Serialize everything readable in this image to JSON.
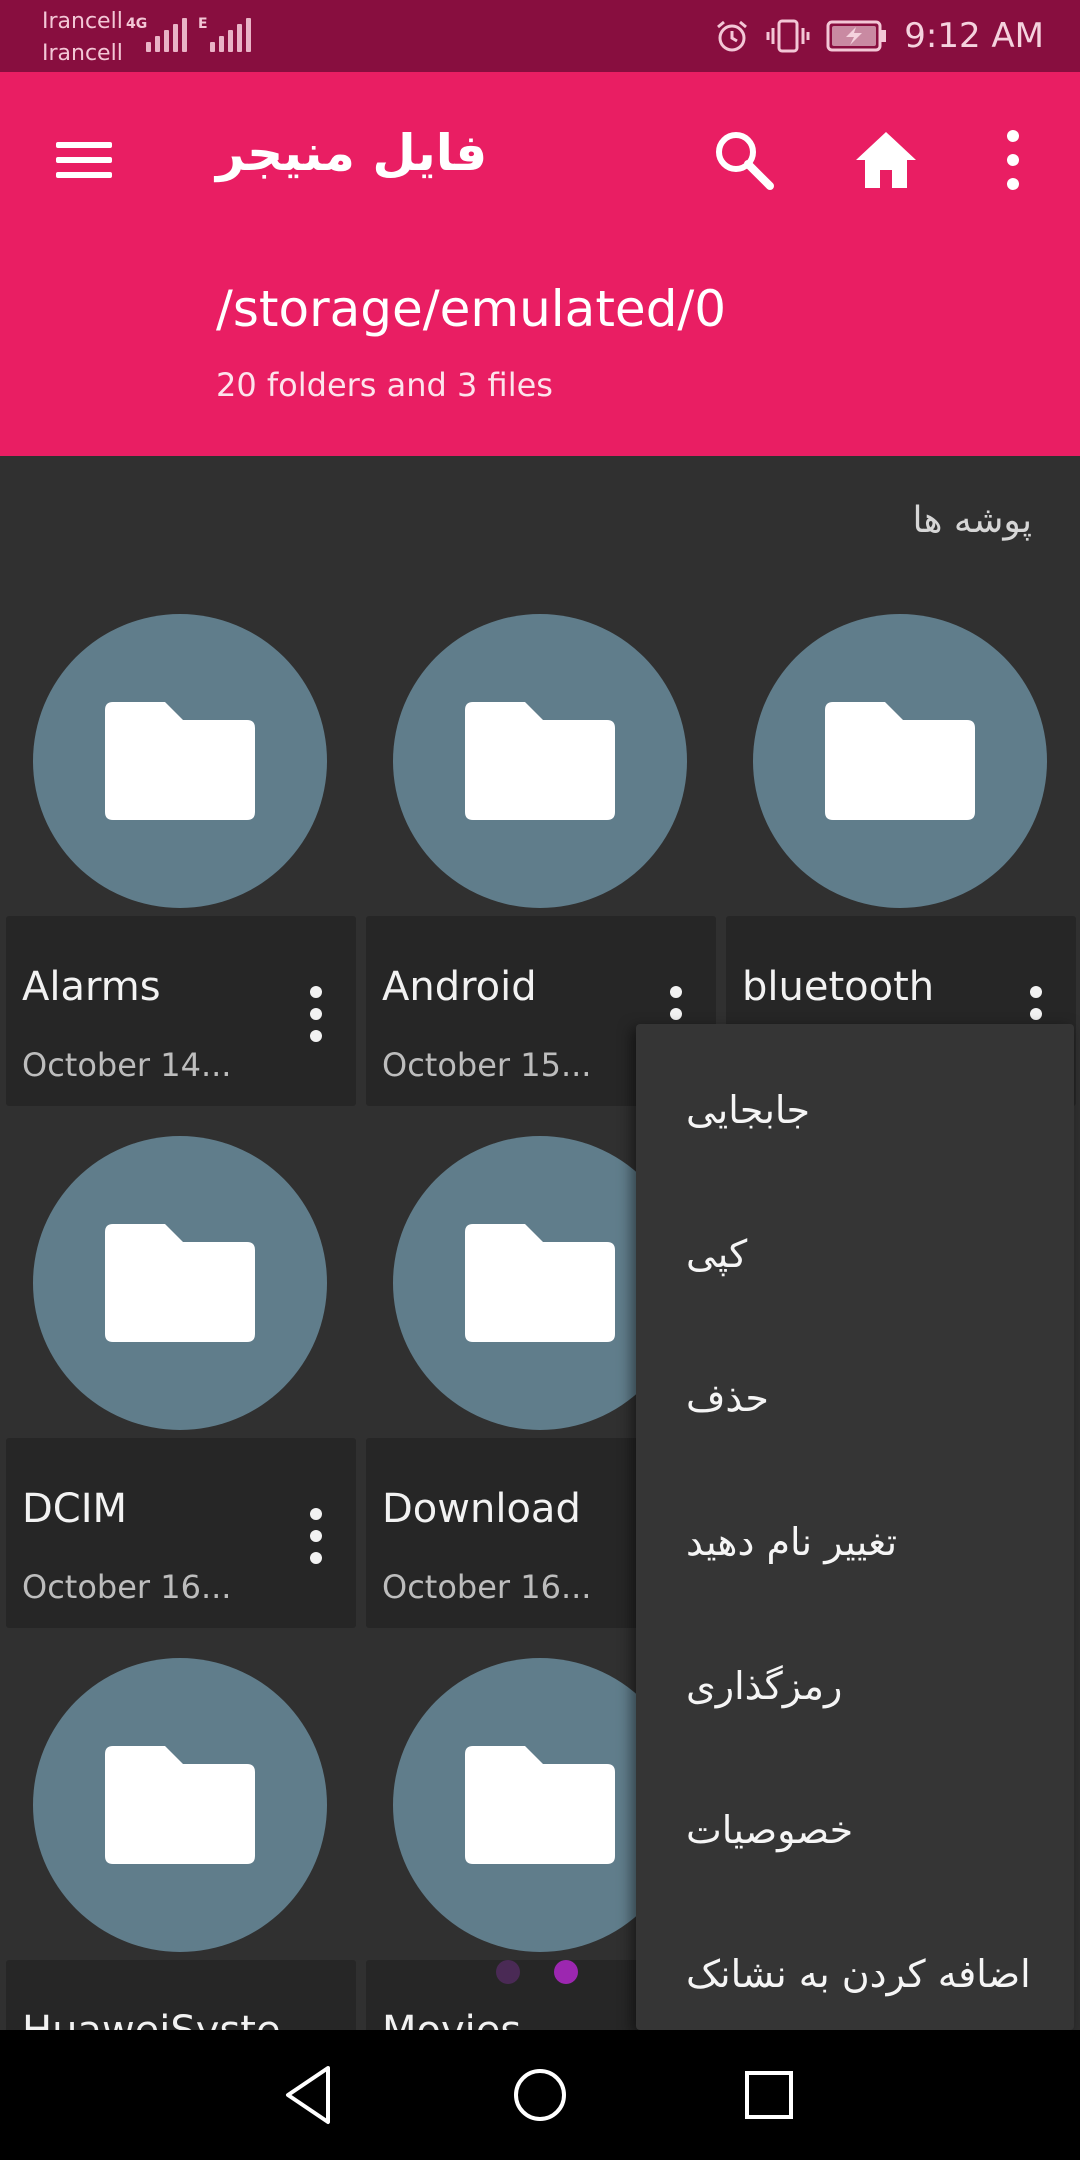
{
  "status_bar": {
    "carrier1": "Irancell",
    "carrier2": "Irancell",
    "net1": "4G",
    "net2": "E",
    "time": "9:12 AM",
    "icons": [
      "alarm-icon",
      "vibrate-icon",
      "battery-charging-icon"
    ]
  },
  "app_bar": {
    "title": "فایل منیجر",
    "path": "/storage/emulated/0",
    "summary": "20 folders and 3 files",
    "icons": [
      "menu-icon",
      "search-icon",
      "home-icon",
      "more-vert-icon"
    ]
  },
  "section": {
    "title": "پوشه ها"
  },
  "folders": [
    {
      "name": "Alarms",
      "date": "October 14..."
    },
    {
      "name": "Android",
      "date": "October 15..."
    },
    {
      "name": "bluetooth",
      "date": ""
    },
    {
      "name": "DCIM",
      "date": "October 16..."
    },
    {
      "name": "Download",
      "date": "October 16..."
    },
    {
      "name": "HuaweiSyste",
      "date": ""
    },
    {
      "name": "Movies",
      "date": ""
    }
  ],
  "context_menu": {
    "items": [
      "جابجایی",
      "کپی",
      "حذف",
      "تغییر نام دهید",
      "رمزگذاری",
      "خصوصیات",
      "اضافه کردن به نشانک"
    ]
  },
  "page_dots": {
    "count": 2,
    "active_index": 1,
    "inactive_color": "#4a2a55",
    "active_color": "#9c27b0"
  },
  "colors": {
    "status_bar": "#880e3f",
    "app_bar": "#e91e63",
    "folder_circle": "#607d8b",
    "background": "#303030"
  },
  "nav_bar": {
    "icons": [
      "back-icon",
      "home-circle-icon",
      "recents-icon"
    ]
  }
}
